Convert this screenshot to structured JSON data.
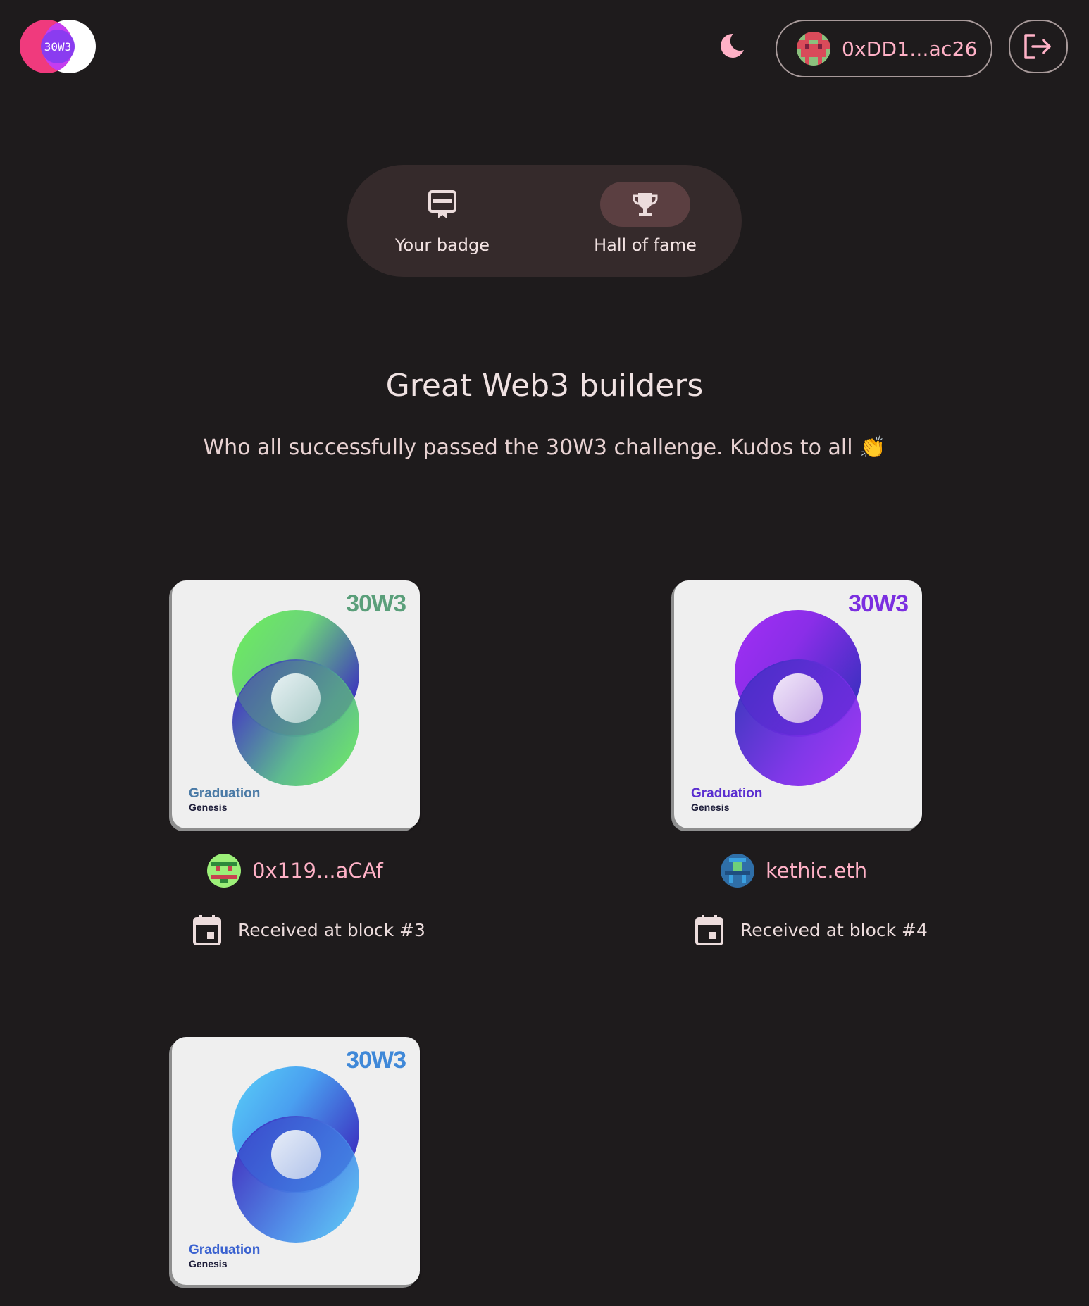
{
  "header": {
    "logo_text": "30W3",
    "wallet_address": "0xDD1...ac26",
    "theme_icon": "moon-icon",
    "logout_icon": "logout-icon"
  },
  "nav": {
    "tabs": [
      {
        "label": "Your badge",
        "icon": "badge-icon",
        "active": false
      },
      {
        "label": "Hall of fame",
        "icon": "trophy-icon",
        "active": true
      }
    ]
  },
  "main": {
    "title": "Great Web3 builders",
    "subtitle": "Who all successfully passed the 30W3 challenge. Kudos to all 👏"
  },
  "badges": [
    {
      "brand": "30W3",
      "line1": "Graduation",
      "line2": "Genesis",
      "owner": "0x119...aCAf",
      "block_text": "Received at block #3",
      "accent": "#5a9f7a"
    },
    {
      "brand": "30W3",
      "line1": "Graduation",
      "line2": "Genesis",
      "owner": "kethic.eth",
      "block_text": "Received at block #4",
      "accent": "#7b2fe0"
    },
    {
      "brand": "30W3",
      "line1": "Graduation",
      "line2": "Genesis",
      "accent": "#3f88d8"
    }
  ],
  "colors": {
    "background": "#1e1b1c",
    "accent_pink": "#ffb1c6",
    "nav_bg": "#352a2b",
    "nav_active": "#5b3f41"
  }
}
